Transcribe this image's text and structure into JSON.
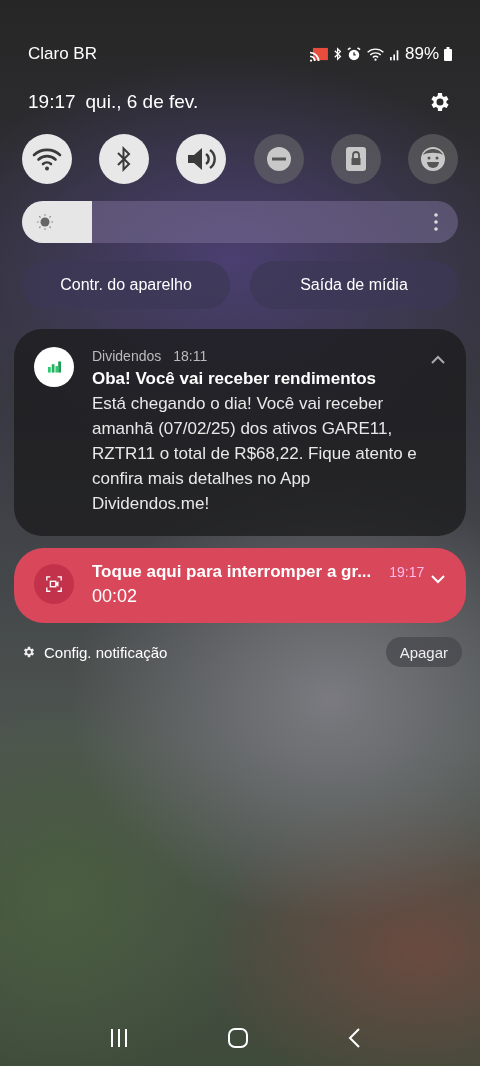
{
  "status_bar": {
    "carrier": "Claro BR",
    "battery": "89%"
  },
  "header": {
    "time": "19:17",
    "date": "qui., 6 de fev."
  },
  "quick_toggles": [
    {
      "kind": "wifi",
      "on": true
    },
    {
      "kind": "bluetooth",
      "on": true
    },
    {
      "kind": "sound",
      "on": true
    },
    {
      "kind": "dnd",
      "on": false
    },
    {
      "kind": "secure",
      "on": false
    },
    {
      "kind": "kids",
      "on": false
    }
  ],
  "brightness": {
    "level": 0.16
  },
  "panel_buttons": [
    "Contr. do aparelho",
    "Saída de mídia"
  ],
  "notifications": [
    {
      "kind": "app",
      "app": "Dividendos",
      "time": "18:11",
      "title": "Oba! Você vai receber rendimentos",
      "body": "Está chegando o dia! Você vai receber amanhã (07/02/25) dos ativos GARE11, RZTR11 o total de R$68,22. Fique atento e confira mais detalhes no App Dividendos.me!",
      "expanded": true
    },
    {
      "kind": "recording",
      "title": "Toque aqui para interromper a gr...",
      "time": "19:17",
      "body": "00:02",
      "expanded": false
    }
  ],
  "footer": {
    "settings": "Config. notificação",
    "clear": "Apagar"
  }
}
